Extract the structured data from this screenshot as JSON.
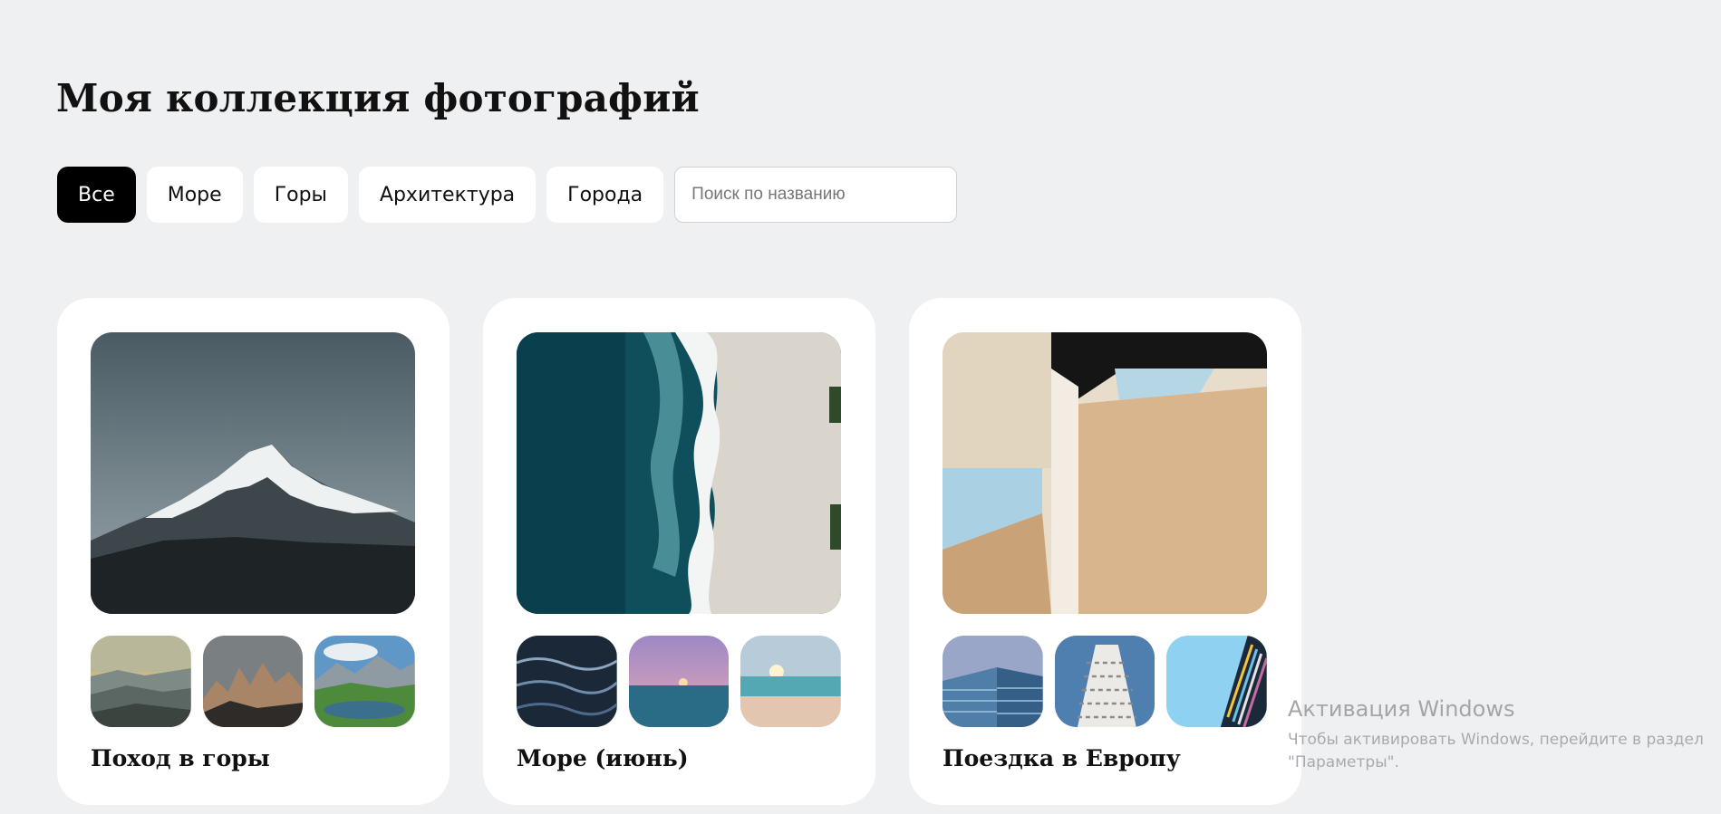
{
  "header": {
    "title": "Моя коллекция фотографий"
  },
  "filters": {
    "chips": [
      "Все",
      "Море",
      "Горы",
      "Архитектура",
      "Города"
    ],
    "active": "Все",
    "search_placeholder": "Поиск по названию"
  },
  "albums": [
    {
      "title": "Поход в горы"
    },
    {
      "title": "Море (июнь)"
    },
    {
      "title": "Поездка в Европу"
    }
  ],
  "watermark": {
    "title": "Активация Windows",
    "line1": "Чтобы активировать Windows, перейдите в раздел",
    "line2": "\"Параметры\"."
  }
}
